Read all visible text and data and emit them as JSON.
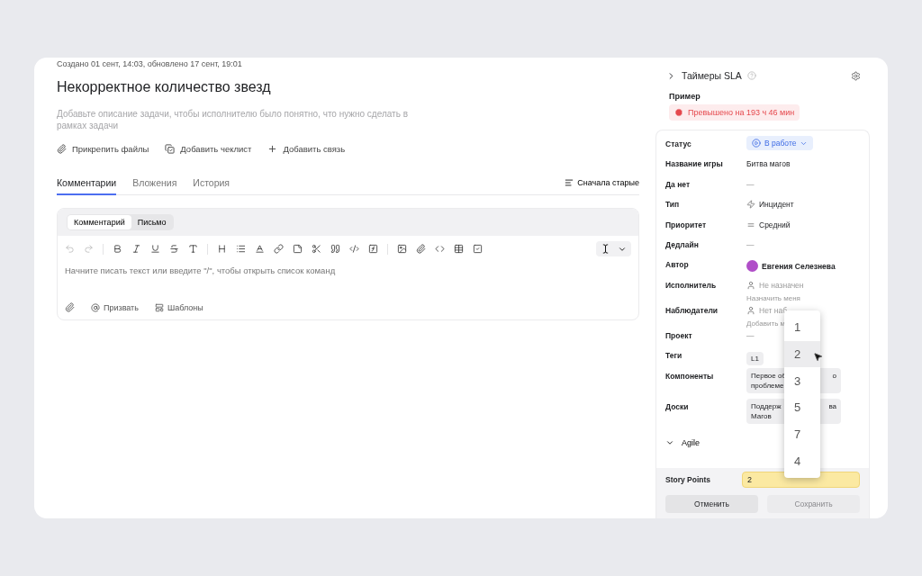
{
  "meta": "Создано 01 сент, 14:03, обновлено 17 сент, 19:01",
  "title": "Некорректное количество звезд",
  "description_placeholder": "Добавьте описание задачи, чтобы исполнителю было понятно, что нужно сделать в рамках задачи",
  "actions": [
    {
      "kind": "attach",
      "label": "Прикрепить файлы"
    },
    {
      "kind": "checklist",
      "label": "Добавить чеклист"
    },
    {
      "kind": "link",
      "label": "Добавить связь"
    }
  ],
  "tabs": [
    {
      "label": "Комментарии",
      "selected": true
    },
    {
      "label": "Вложения",
      "selected": false
    },
    {
      "label": "История",
      "selected": false
    }
  ],
  "sort": "Сначала старые",
  "editor": {
    "modes": [
      {
        "label": "Комментарий",
        "selected": true
      },
      {
        "label": "Письмо",
        "selected": false
      }
    ],
    "placeholder": "Начните писать текст или введите \"/\", чтобы открыть список команд",
    "footer": [
      {
        "kind": "attach"
      },
      {
        "kind": "mention",
        "label": "Призвать"
      },
      {
        "kind": "templates",
        "label": "Шаблоны"
      }
    ]
  },
  "sla": {
    "title": "Таймеры SLA",
    "name": "Пример",
    "badge": "Превышено на 193 ч 46 мин"
  },
  "fields": [
    {
      "label": "Статус",
      "kind": "status",
      "value": "В работе"
    },
    {
      "label": "Название игры",
      "kind": "text",
      "value": "Битва магов"
    },
    {
      "label": "Да нет",
      "kind": "dash",
      "value": "—"
    },
    {
      "label": "Тип",
      "kind": "type",
      "value": "Инцидент"
    },
    {
      "label": "Приоритет",
      "kind": "priority",
      "value": "Средний"
    },
    {
      "label": "Дедлайн",
      "kind": "dash",
      "value": "—"
    },
    {
      "label": "Автор",
      "kind": "user",
      "value": "Евгения Селезнева"
    },
    {
      "label": "Исполнитель",
      "kind": "person",
      "value": "Не назначен",
      "link": "Назначить меня"
    },
    {
      "label": "Наблюдатели",
      "kind": "person",
      "value": "Нет наб",
      "link": "Добавить м"
    },
    {
      "label": "Проект",
      "kind": "dash",
      "value": "—"
    },
    {
      "label": "Теги",
      "kind": "tag",
      "value": "L1"
    },
    {
      "label": "Компоненты",
      "kind": "chip",
      "lines": [
        "Первое об",
        "проблеме"
      ],
      "tail": "о"
    },
    {
      "label": "Доски",
      "kind": "chip",
      "lines": [
        "Поддерж",
        "Магов"
      ],
      "tail": "ва"
    }
  ],
  "agile": {
    "title": "Agile",
    "expanded": true
  },
  "story_points": {
    "label": "Story Points",
    "value": "2"
  },
  "buttons": [
    {
      "label": "Отменить",
      "disabled": false
    },
    {
      "label": "Сохранить",
      "disabled": true
    }
  ],
  "dropdown": [
    {
      "label": "1",
      "selected": false
    },
    {
      "label": "2",
      "selected": true
    },
    {
      "label": "3",
      "selected": false
    },
    {
      "label": "5",
      "selected": false
    },
    {
      "label": "7",
      "selected": false
    },
    {
      "label": "4",
      "selected": false
    }
  ]
}
